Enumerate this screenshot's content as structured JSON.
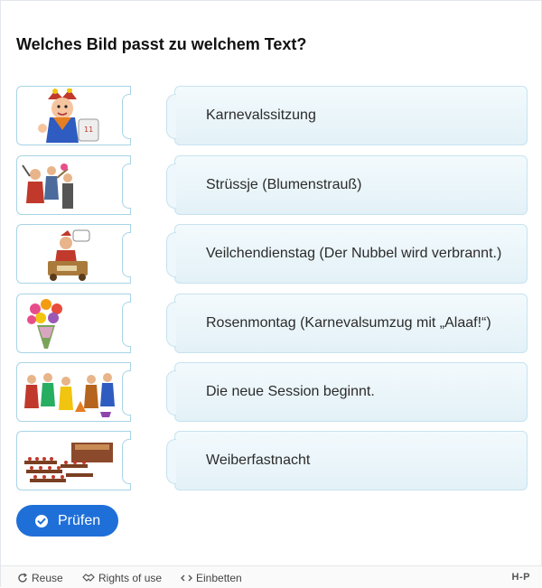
{
  "question": "Welches Bild passt zu welchem Text?",
  "pairs": [
    {
      "image": "jester-clock-image",
      "text": "Karnevalssitzung"
    },
    {
      "image": "people-dancing-image",
      "text": "Strüssje (Blumenstrauß)"
    },
    {
      "image": "figure-in-cart-image",
      "text": "Veilchendienstag (Der Nubbel wird verbrannt.)"
    },
    {
      "image": "flower-bouquet-image",
      "text": "Rosenmontag (Karnevalsumzug mit „Alaaf!“)"
    },
    {
      "image": "costumed-group-image",
      "text": "Die neue Session beginnt."
    },
    {
      "image": "banquet-hall-image",
      "text": "Weiberfastnacht"
    }
  ],
  "check_button": {
    "label": "Prüfen",
    "icon": "check-circle-icon"
  },
  "footer": {
    "reuse": "Reuse",
    "rights": "Rights of use",
    "embed": "Einbetten",
    "logo": "H-P"
  },
  "colors": {
    "accent": "#1f6fd8",
    "card_border": "#a8d4e6",
    "text_card_bg": "#e9f5fa"
  }
}
